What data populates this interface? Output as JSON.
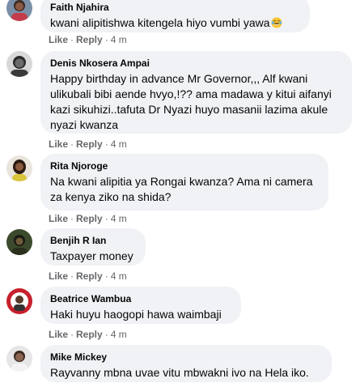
{
  "comments": [
    {
      "author": "Faith Njahira",
      "text": "kwani alipitishwa kitengela hiyo vumbi yawa",
      "emoji": "laughing-crying-emoji",
      "like": "Like",
      "reply": "Reply",
      "time": "4 m"
    },
    {
      "author": "Denis Nkosera Ampai",
      "text": "Happy birthday in advance Mr Governor,,, Alf kwani ulikubali bibi aende hvyo,!?? ama madawa y kitui aifanyi kazi sikuhizi..tafuta Dr Nyazi huyo masanii lazima akule nyazi kwanza",
      "like": "Like",
      "reply": "Reply",
      "time": "4 m"
    },
    {
      "author": "Rita Njoroge",
      "text": "Na kwani alipitia ya Rongai kwanza? Ama ni camera za kenya ziko na shida?",
      "like": "Like",
      "reply": "Reply",
      "time": "4 m"
    },
    {
      "author": "Benjih R Ian",
      "text": "Taxpayer money",
      "like": "Like",
      "reply": "Reply",
      "time": "4 m"
    },
    {
      "author": "Beatrice Wambua",
      "text": "Haki huyu haogopi hawa waimbaji",
      "like": "Like",
      "reply": "Reply",
      "time": "4 m"
    },
    {
      "author": "Mike Mickey",
      "text": "Rayvanny mbna uvae vitu mbwakni ivo na Hela iko.",
      "like": "Like",
      "reply": "Reply",
      "time": "4 m"
    }
  ],
  "separator": "·",
  "colors": {
    "bubble": "#f0f2f5",
    "text": "#050505",
    "meta": "#65676b"
  }
}
